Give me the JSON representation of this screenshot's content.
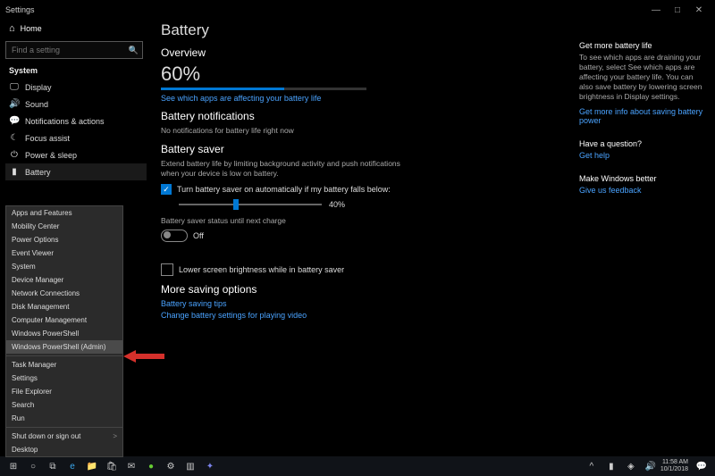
{
  "titlebar": {
    "title": "Settings"
  },
  "sidebar": {
    "home": "Home",
    "search_placeholder": "Find a setting",
    "section": "System",
    "items": [
      "Display",
      "Sound",
      "Notifications & actions",
      "Focus assist",
      "Power & sleep",
      "Battery"
    ]
  },
  "context_menu": {
    "items1": [
      "Apps and Features",
      "Mobility Center",
      "Power Options",
      "Event Viewer",
      "System",
      "Device Manager",
      "Network Connections",
      "Disk Management",
      "Computer Management",
      "Windows PowerShell",
      "Windows PowerShell (Admin)"
    ],
    "items2": [
      "Task Manager",
      "Settings",
      "File Explorer",
      "Search",
      "Run"
    ],
    "items3": [
      "Shut down or sign out",
      "Desktop"
    ]
  },
  "main": {
    "title": "Battery",
    "overview_h": "Overview",
    "pct": "60%",
    "pct_num": 60,
    "apps_link": "See which apps are affecting your battery life",
    "notif_h": "Battery notifications",
    "notif_body": "No notifications for battery life right now",
    "saver_h": "Battery saver",
    "saver_desc": "Extend battery life by limiting background activity and push notifications when your device is low on battery.",
    "saver_chk": "Turn battery saver on automatically if my battery falls below:",
    "saver_pct": "40%",
    "saver_pct_num": 40,
    "saver_status": "Battery saver status until next charge",
    "saver_toggle": "Off",
    "lower_chk": "Lower screen brightness while in battery saver",
    "more_h": "More saving options",
    "tips_link": "Battery saving tips",
    "video_link": "Change battery settings for playing video"
  },
  "right": {
    "h1": "Get more battery life",
    "p1": "To see which apps are draining your battery, select See which apps are affecting your battery life. You can also save battery by lowering screen brightness in Display settings.",
    "l1": "Get more info about saving battery power",
    "h2": "Have a question?",
    "l2": "Get help",
    "h3": "Make Windows better",
    "l3": "Give us feedback"
  },
  "taskbar": {
    "time": "11:58 AM",
    "date": "10/1/2018"
  }
}
